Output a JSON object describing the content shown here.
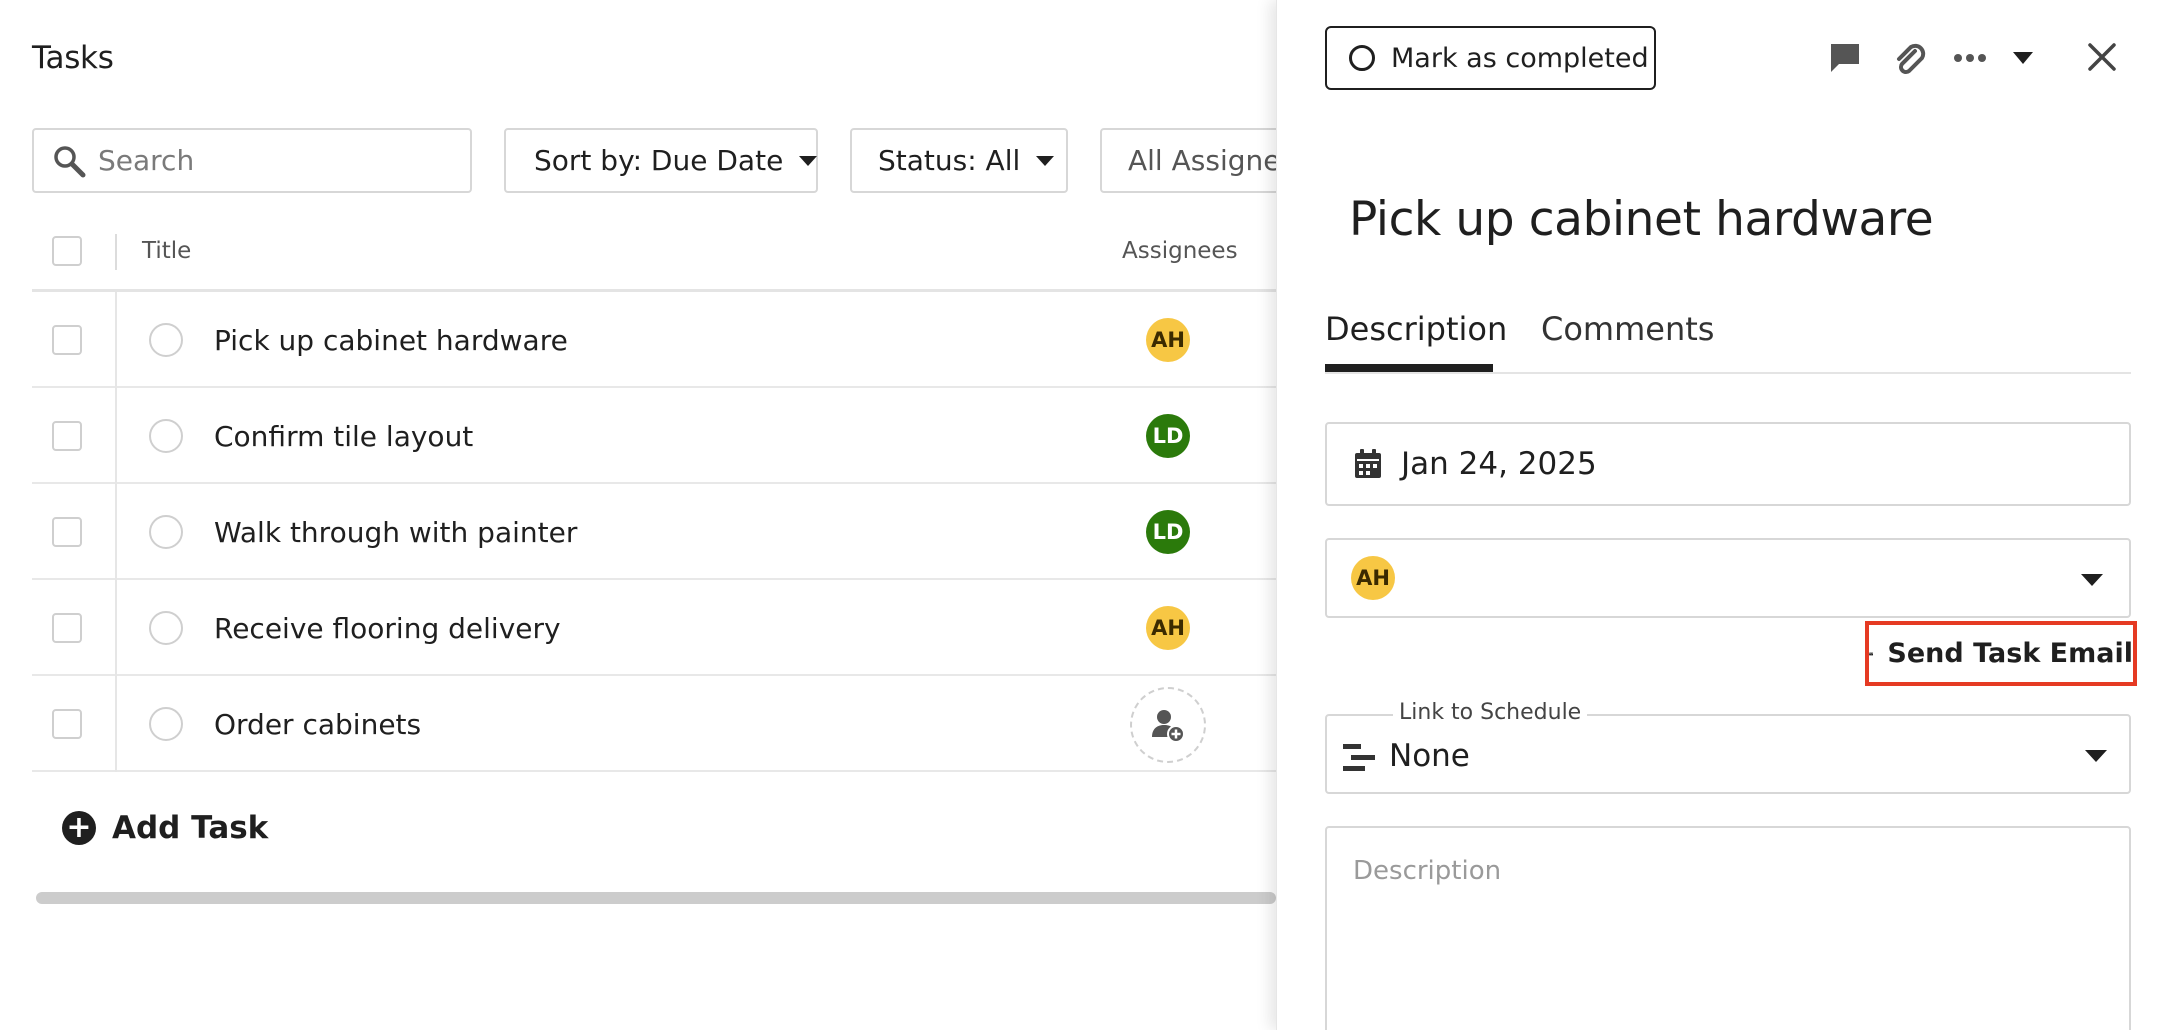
{
  "page": {
    "title": "Tasks"
  },
  "toolbar": {
    "search_placeholder": "Search",
    "sort_label": "Sort by: Due Date",
    "status_label": "Status: All",
    "assignees_label": "All Assignees"
  },
  "table": {
    "columns": {
      "title": "Title",
      "assignees": "Assignees"
    },
    "rows": [
      {
        "title": "Pick up cabinet hardware",
        "assignee": "AH"
      },
      {
        "title": "Confirm tile layout",
        "assignee": "LD"
      },
      {
        "title": "Walk through with painter",
        "assignee": "LD"
      },
      {
        "title": "Receive flooring delivery",
        "assignee": "AH"
      },
      {
        "title": "Order cabinets",
        "assignee": ""
      }
    ]
  },
  "add_task": {
    "label": "Add Task"
  },
  "panel": {
    "mark_completed": "Mark as completed",
    "task_title": "Pick up cabinet hardware",
    "tabs": {
      "description": "Description",
      "comments": "Comments"
    },
    "due_date": "Jan 24, 2025",
    "assignee": "AH",
    "send_email": "Send Task Email",
    "link_to_schedule": {
      "label": "Link to Schedule",
      "value": "None"
    },
    "description_placeholder": "Description"
  },
  "colors": {
    "avatar_ah": "#f7c744",
    "avatar_ld": "#2b7a0b",
    "highlight": "#e53a23"
  },
  "icons": {
    "search": "search-icon",
    "chat": "chat-icon",
    "attachment": "paperclip-icon",
    "more": "more-icon",
    "close": "close-icon",
    "calendar": "calendar-icon",
    "email": "envelope-icon",
    "schedule": "schedule-bars-icon",
    "add": "plus-circle-icon",
    "add_assignee": "add-user-icon"
  }
}
